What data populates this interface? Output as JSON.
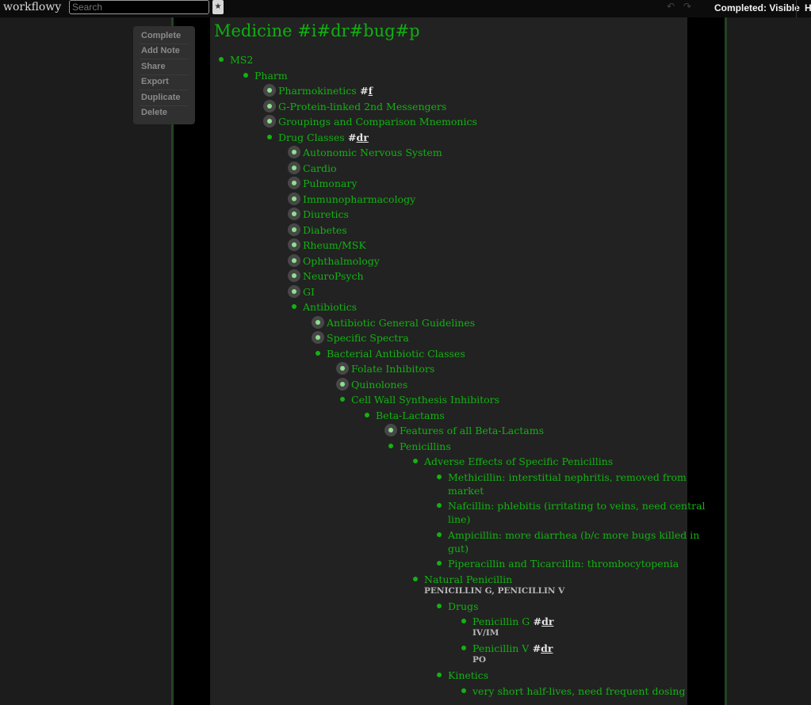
{
  "topbar": {
    "logo": "workflowy",
    "search_placeholder": "Search",
    "star_glyph": "★",
    "undo_glyph": "↶",
    "redo_glyph": "↷",
    "completed_label": "Completed: Visible",
    "help_label": "H"
  },
  "menu": {
    "items": [
      "Complete",
      "Add Note",
      "Share",
      "Export",
      "Duplicate",
      "Delete"
    ]
  },
  "page": {
    "title": "Medicine #i#dr#bug#p"
  },
  "outline": [
    {
      "text": "MS2",
      "depth": 0,
      "collapsed": false
    },
    {
      "text": "Pharm",
      "depth": 1,
      "collapsed": false
    },
    {
      "text": "Pharmokinetics",
      "tag": "f",
      "depth": 2,
      "collapsed": true
    },
    {
      "text": "G-Protein-linked 2nd Messengers",
      "depth": 2,
      "collapsed": true
    },
    {
      "text": "Groupings and Comparison Mnemonics",
      "depth": 2,
      "collapsed": true
    },
    {
      "text": "Drug Classes",
      "tag": "dr",
      "depth": 2,
      "collapsed": false
    },
    {
      "text": "Autonomic Nervous System",
      "depth": 3,
      "collapsed": true
    },
    {
      "text": "Cardio",
      "depth": 3,
      "collapsed": true
    },
    {
      "text": "Pulmonary",
      "depth": 3,
      "collapsed": true
    },
    {
      "text": "Immunopharmacology",
      "depth": 3,
      "collapsed": true
    },
    {
      "text": "Diuretics",
      "depth": 3,
      "collapsed": true
    },
    {
      "text": "Diabetes",
      "depth": 3,
      "collapsed": true
    },
    {
      "text": "Rheum/MSK",
      "depth": 3,
      "collapsed": true
    },
    {
      "text": "Ophthalmology",
      "depth": 3,
      "collapsed": true
    },
    {
      "text": "NeuroPsych",
      "depth": 3,
      "collapsed": true
    },
    {
      "text": "GI",
      "depth": 3,
      "collapsed": true
    },
    {
      "text": "Antibiotics",
      "depth": 3,
      "collapsed": false
    },
    {
      "text": "Antibiotic General Guidelines",
      "depth": 4,
      "collapsed": true
    },
    {
      "text": "Specific Spectra",
      "depth": 4,
      "collapsed": true
    },
    {
      "text": "Bacterial Antibiotic Classes",
      "depth": 4,
      "collapsed": false
    },
    {
      "text": "Folate Inhibitors",
      "depth": 5,
      "collapsed": true
    },
    {
      "text": "Quinolones",
      "depth": 5,
      "collapsed": true
    },
    {
      "text": "Cell Wall Synthesis Inhibitors",
      "depth": 5,
      "collapsed": false
    },
    {
      "text": "Beta-Lactams",
      "depth": 6,
      "collapsed": false
    },
    {
      "text": "Features of all Beta-Lactams",
      "depth": 7,
      "collapsed": true
    },
    {
      "text": "Penicillins",
      "depth": 7,
      "collapsed": false
    },
    {
      "text": "Adverse Effects of Specific Penicillins",
      "depth": 8,
      "collapsed": false
    },
    {
      "lines": [
        "Methicillin: interstitial nephritis, removed from",
        "market"
      ],
      "depth": 9,
      "collapsed": false
    },
    {
      "lines": [
        "Nafcillin: phlebitis (irritating to veins, need central",
        "line)"
      ],
      "depth": 9,
      "collapsed": false
    },
    {
      "lines": [
        "Ampicillin: more diarrhea (b/c more bugs killed in",
        "gut)"
      ],
      "depth": 9,
      "collapsed": false
    },
    {
      "text": "Piperacillin and Ticarcillin: thrombocytopenia",
      "depth": 9,
      "collapsed": false
    },
    {
      "text": "Natural Penicillin",
      "note": "PENICILLIN G, PENICILLIN V",
      "depth": 8,
      "collapsed": false
    },
    {
      "text": "Drugs",
      "depth": 9,
      "collapsed": false
    },
    {
      "text": "Penicillin G",
      "tag": "dr",
      "note": "IV/IM",
      "depth": 10,
      "collapsed": false
    },
    {
      "text": "Penicillin V",
      "tag": "dr",
      "note": "PO",
      "depth": 10,
      "collapsed": false
    },
    {
      "text": "Kinetics",
      "depth": 9,
      "collapsed": false
    },
    {
      "text": "very short half-lives, need frequent dosing",
      "depth": 10,
      "collapsed": false
    }
  ]
}
